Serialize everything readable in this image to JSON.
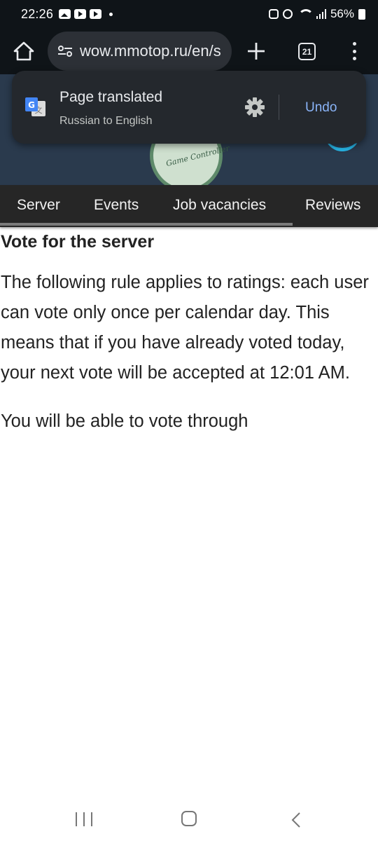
{
  "status_bar": {
    "time": "22:26",
    "battery": "56%"
  },
  "browser": {
    "url": "wow.mmotop.ru/en/s",
    "tab_count": "21",
    "icons": {
      "home": "home-icon",
      "site_info": "tune-icon",
      "new_tab": "plus-icon",
      "menu": "more-vert-icon"
    }
  },
  "translate_popup": {
    "title": "Page translated",
    "subtitle": "Russian to English",
    "undo_label": "Undo",
    "icons": {
      "translate": "google-translate-icon",
      "settings": "gear-icon"
    }
  },
  "site_header": {
    "logo_text": "Game Controller"
  },
  "nav_tabs": [
    {
      "label": "Server"
    },
    {
      "label": "Events"
    },
    {
      "label": "Job vacancies"
    },
    {
      "label": "Reviews"
    }
  ],
  "content": {
    "heading": "Vote for the server",
    "paragraph1": "The following rule applies to ratings: each user can vote only once per calendar day. This means that if you have already voted today, your next vote will be accepted at 12:01 AM.",
    "paragraph2": "You will be able to vote through"
  },
  "colors": {
    "status_bg": "#0f1418",
    "url_pill": "#2c3036",
    "popup_bg": "#24282d",
    "link_blue": "#8ab4f8",
    "nav_bg": "#262626",
    "header_bg": "#2a3a4d",
    "accent_cyan": "#27b5e6"
  }
}
